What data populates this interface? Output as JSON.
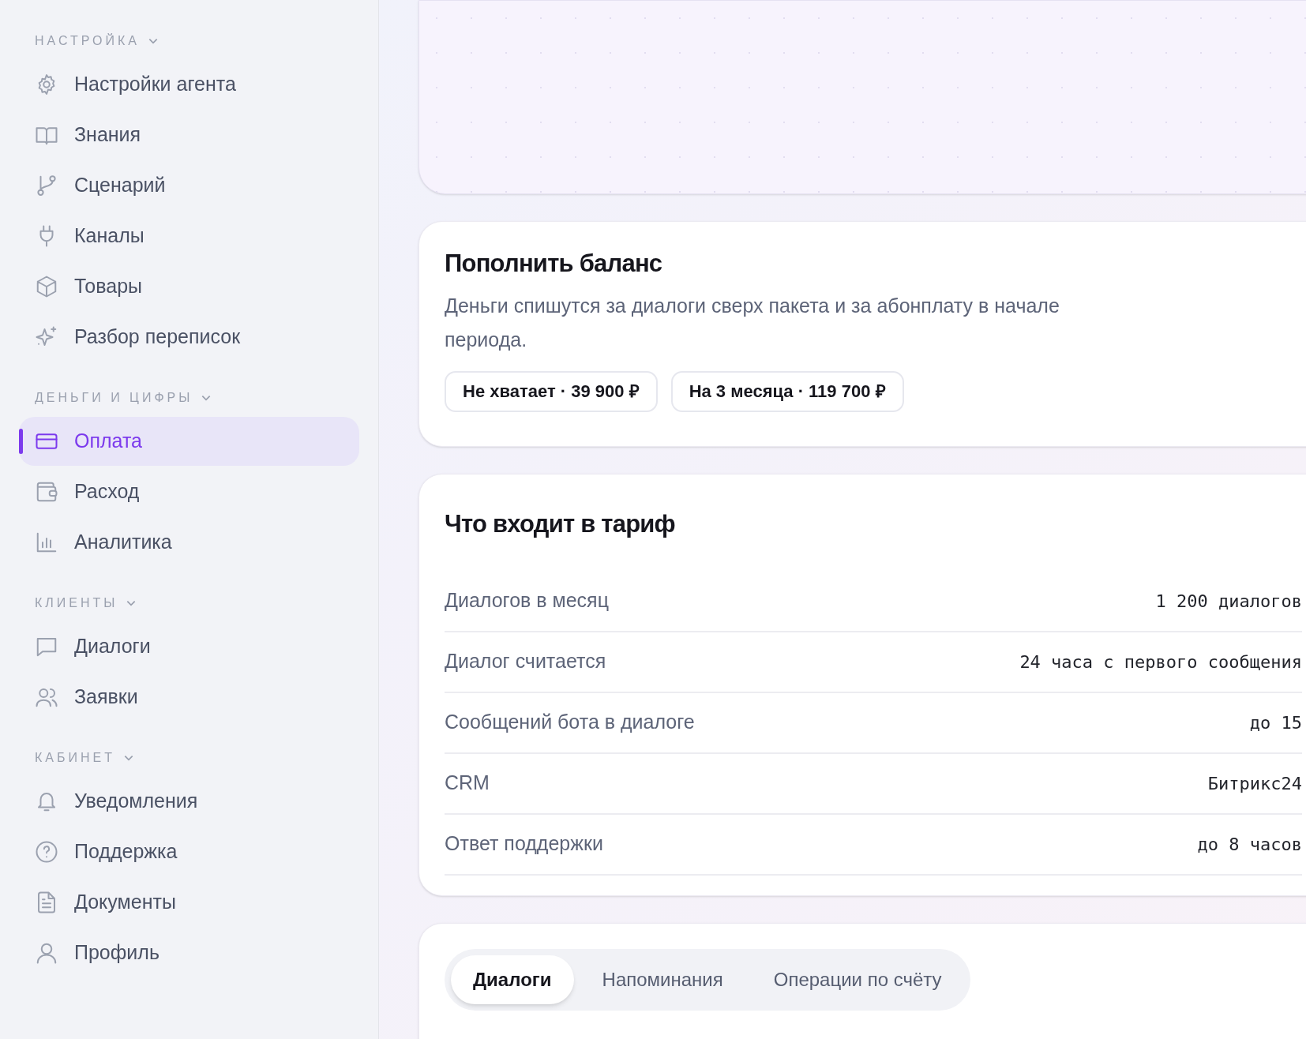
{
  "sidebar": {
    "sections": [
      {
        "title": "НАСТРОЙКА",
        "expanded": true,
        "items": [
          {
            "label": "Настройки агента",
            "kind": "gear",
            "selected": false
          },
          {
            "label": "Знания",
            "kind": "book",
            "selected": false
          },
          {
            "label": "Сценарий",
            "kind": "branch",
            "selected": false
          },
          {
            "label": "Каналы",
            "kind": "plug",
            "selected": false
          },
          {
            "label": "Товары",
            "kind": "box",
            "selected": false
          },
          {
            "label": "Разбор переписок",
            "kind": "sparkle",
            "selected": false
          }
        ]
      },
      {
        "title": "ДЕНЬГИ И ЦИФРЫ",
        "expanded": true,
        "items": [
          {
            "label": "Оплата",
            "kind": "card",
            "selected": true
          },
          {
            "label": "Расход",
            "kind": "wallet",
            "selected": false
          },
          {
            "label": "Аналитика",
            "kind": "chart",
            "selected": false
          }
        ]
      },
      {
        "title": "КЛИЕНТЫ",
        "expanded": true,
        "items": [
          {
            "label": "Диалоги",
            "kind": "chat",
            "selected": false
          },
          {
            "label": "Заявки",
            "kind": "users",
            "selected": false
          }
        ]
      },
      {
        "title": "КАБИНЕТ",
        "expanded": true,
        "items": [
          {
            "label": "Уведомления",
            "kind": "bell",
            "selected": false
          },
          {
            "label": "Поддержка",
            "kind": "help",
            "selected": false
          },
          {
            "label": "Документы",
            "kind": "doc",
            "selected": false
          },
          {
            "label": "Профиль",
            "kind": "user",
            "selected": false
          }
        ]
      }
    ]
  },
  "top_up": {
    "title": "Пополнить баланс",
    "description": "Деньги спишутся за диалоги сверх пакета и за абонплату в начале периода.",
    "buttons": [
      "Не хватает · 39 900 ₽",
      "На 3 месяца · 119 700 ₽"
    ]
  },
  "plan": {
    "title": "Что входит в тариф",
    "rows": [
      {
        "label": "Диалогов в месяц",
        "value": "1 200 диалогов"
      },
      {
        "label": "Диалог считается",
        "value": "24 часа с первого сообщения"
      },
      {
        "label": "Сообщений бота в диалоге",
        "value": "до 15"
      },
      {
        "label": "CRM",
        "value": "Битрикс24"
      },
      {
        "label": "Ответ поддержки",
        "value": "до 8 часов"
      }
    ]
  },
  "history": {
    "tabs": [
      {
        "label": "Диалоги",
        "selected": true
      },
      {
        "label": "Напоминания",
        "selected": false
      },
      {
        "label": "Операции по счёту",
        "selected": false
      }
    ]
  }
}
